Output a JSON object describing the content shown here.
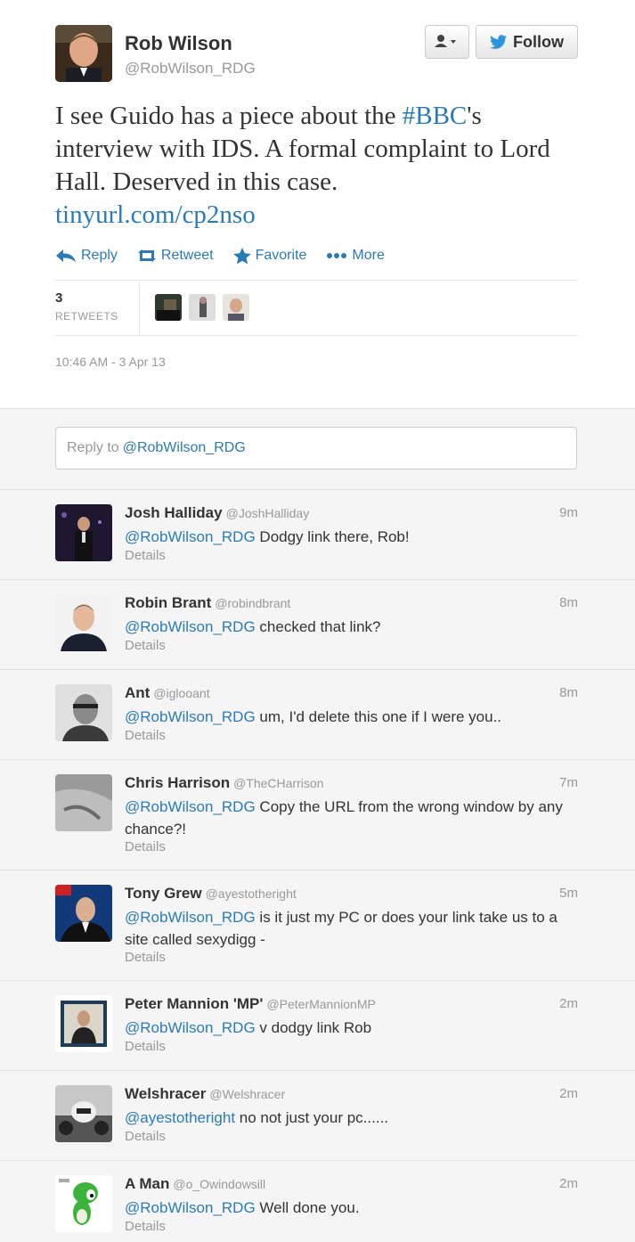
{
  "tweet": {
    "author_name": "Rob Wilson",
    "author_handle": "@RobWilson_RDG",
    "follow_label": "Follow",
    "text_parts": {
      "pre": "I see Guido has a piece about the ",
      "hashtag": "#BBC",
      "post": "'s interview with IDS. A formal complaint to Lord Hall. Deserved in this case.",
      "url": "tinyurl.com/cp2nso"
    },
    "actions": {
      "reply": "Reply",
      "retweet": "Retweet",
      "favorite": "Favorite",
      "more": "More"
    },
    "retweet_count": "3",
    "retweet_label": "RETWEETS",
    "timestamp": "10:46 AM - 3 Apr 13"
  },
  "reply_box": {
    "prefix": "Reply to ",
    "handle": "@RobWilson_RDG"
  },
  "replies": [
    {
      "name": "Josh Halliday",
      "handle": "@JoshHalliday",
      "time": "9m",
      "mention": "@RobWilson_RDG",
      "text": " Dodgy link there, Rob!",
      "details": "Details"
    },
    {
      "name": "Robin Brant",
      "handle": "@robindbrant",
      "time": "8m",
      "mention": "@RobWilson_RDG",
      "text": " checked that link?",
      "details": "Details"
    },
    {
      "name": "Ant",
      "handle": "@iglooant",
      "time": "8m",
      "mention": "@RobWilson_RDG",
      "text": " um, I'd delete this one if I were you..",
      "details": "Details"
    },
    {
      "name": "Chris Harrison",
      "handle": "@TheCHarrison",
      "time": "7m",
      "mention": "@RobWilson_RDG",
      "text": " Copy the URL from the wrong window by any chance?!",
      "details": "Details"
    },
    {
      "name": "Tony Grew",
      "handle": "@ayestotheright",
      "time": "5m",
      "mention": "@RobWilson_RDG",
      "text": " is it just my PC or does your link take us to a site called sexydigg -",
      "details": "Details"
    },
    {
      "name": "Peter Mannion 'MP'",
      "handle": "@PeterMannionMP",
      "time": "2m",
      "mention": "@RobWilson_RDG",
      "text": " v dodgy link Rob",
      "details": "Details"
    },
    {
      "name": "Welshracer",
      "handle": "@Welshracer",
      "time": "2m",
      "mention": "@ayestotheright",
      "text": " no not just your pc......",
      "details": "Details"
    },
    {
      "name": "A Man",
      "handle": "@o_Owindowsill",
      "time": "2m",
      "mention": "@RobWilson_RDG",
      "text": " Well done you.",
      "details": "Details"
    }
  ],
  "colors": {
    "link": "#2a7bb5",
    "muted": "#999999",
    "text": "#333333",
    "background": "#f5f5f5"
  },
  "icons": {
    "reply": "reply-arrow-icon",
    "retweet": "retweet-icon",
    "favorite": "star-icon",
    "more": "dots-icon",
    "follow": "bird-icon",
    "user": "user-menu-icon"
  }
}
